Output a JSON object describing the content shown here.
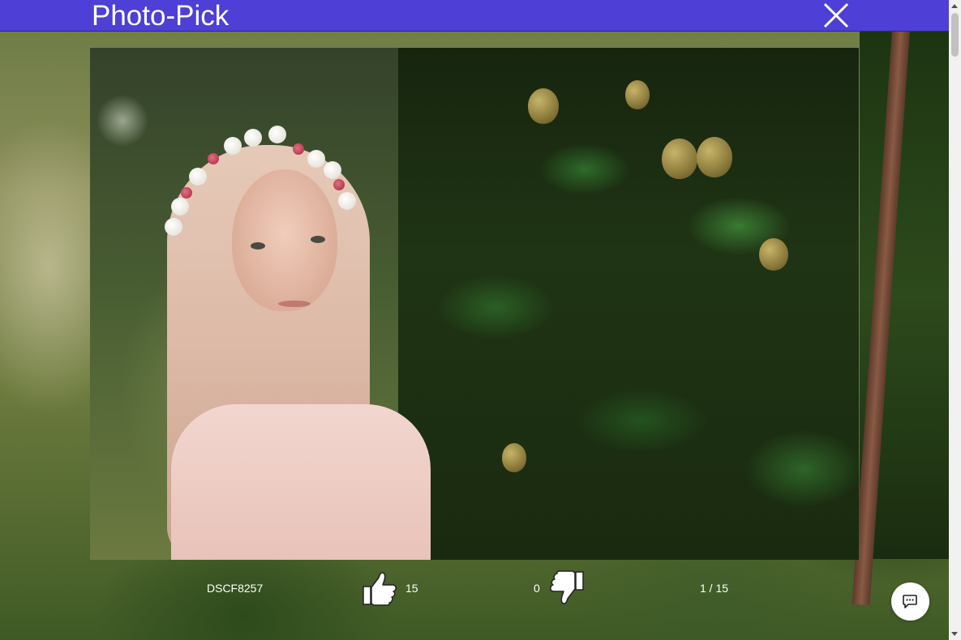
{
  "header": {
    "title": "Photo-Pick",
    "close_icon": "close-icon",
    "background_color": "#4e3fd6"
  },
  "photo": {
    "name": "DSCF8257",
    "likes": "15",
    "dislikes": "0",
    "counter": "1 / 15"
  },
  "icons": {
    "like": "thumbs-up-icon",
    "dislike": "thumbs-down-icon",
    "chat": "chat-icon"
  }
}
